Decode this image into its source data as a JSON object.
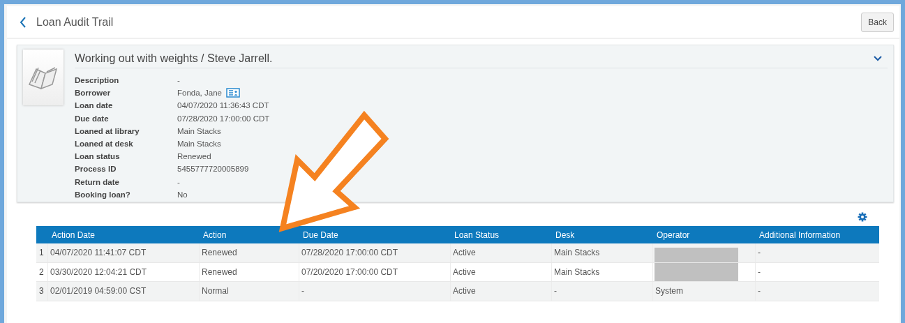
{
  "header": {
    "title": "Loan Audit Trail",
    "back_button": "Back"
  },
  "item": {
    "title": "Working out with weights / Steve Jarrell.",
    "expanded": false,
    "fields": [
      {
        "label": "Description",
        "value": "-"
      },
      {
        "label": "Borrower",
        "value": "Fonda, Jane",
        "kind": "patron"
      },
      {
        "label": "Loan date",
        "value": "04/07/2020 11:36:43 CDT"
      },
      {
        "label": "Due date",
        "value": "07/28/2020 17:00:00 CDT"
      },
      {
        "label": "Loaned at library",
        "value": "Main Stacks"
      },
      {
        "label": "Loaned at desk",
        "value": "Main Stacks"
      },
      {
        "label": "Loan status",
        "value": "Renewed"
      },
      {
        "label": "Process ID",
        "value": "5455777720005899"
      },
      {
        "label": "Return date",
        "value": "-"
      },
      {
        "label": "Booking loan?",
        "value": "No"
      }
    ]
  },
  "table": {
    "columns": [
      "Action Date",
      "Action",
      "Due Date",
      "Loan Status",
      "Desk",
      "Operator",
      "Additional Information"
    ],
    "rows": [
      {
        "number": "1",
        "cells": [
          "04/07/2020 11:41:07 CDT",
          "Renewed",
          "07/28/2020 17:00:00 CDT",
          "Active",
          "Main Stacks",
          null,
          "-"
        ],
        "operator_redacted": true
      },
      {
        "number": "2",
        "cells": [
          "03/30/2020 12:04:21 CDT",
          "Renewed",
          "07/20/2020 17:00:00 CDT",
          "Active",
          "Main Stacks",
          null,
          "-"
        ],
        "operator_redacted": true
      },
      {
        "number": "3",
        "cells": [
          "02/01/2019 04:59:00 CST",
          "Normal",
          "-",
          "Active",
          "-",
          "System",
          "-"
        ],
        "operator_redacted": false
      }
    ]
  }
}
